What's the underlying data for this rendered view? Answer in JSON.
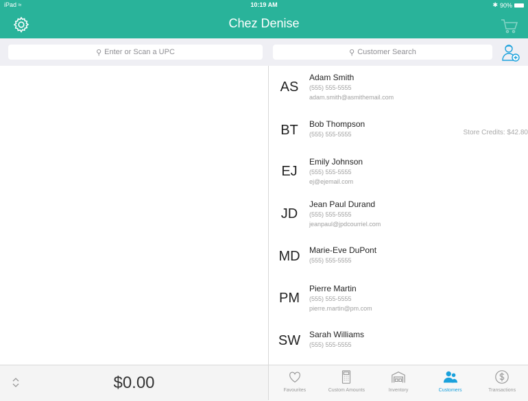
{
  "status": {
    "device": "iPad",
    "time": "10:19 AM",
    "battery": "90%"
  },
  "header": {
    "title": "Chez Denise",
    "icons": [
      "gear-icon",
      "cart-icon"
    ]
  },
  "search": {
    "upc_placeholder": "Enter or Scan a UPC",
    "customer_placeholder": "Customer Search"
  },
  "colors": {
    "brand": "#29b39a",
    "active_tab": "#1aa1dc"
  },
  "customers": [
    {
      "initials": "AS",
      "name": "Adam Smith",
      "phone": "(555) 555-5555",
      "email": "adam.smith@asmithemail.com",
      "credit": ""
    },
    {
      "initials": "BT",
      "name": "Bob Thompson",
      "phone": "(555) 555-5555",
      "email": "",
      "credit": "Store Credits: $42.80"
    },
    {
      "initials": "EJ",
      "name": "Emily Johnson",
      "phone": "(555) 555-5555",
      "email": "ej@ejemail.com",
      "credit": ""
    },
    {
      "initials": "JD",
      "name": "Jean Paul Durand",
      "phone": "(555) 555-5555",
      "email": "jeanpaul@jpdcourriel.com",
      "credit": ""
    },
    {
      "initials": "MD",
      "name": "Marie-Eve DuPont",
      "phone": "(555) 555-5555",
      "email": "",
      "credit": ""
    },
    {
      "initials": "PM",
      "name": "Pierre Martin",
      "phone": "(555) 555-5555",
      "email": "pierre.martin@pm.com",
      "credit": ""
    },
    {
      "initials": "SW",
      "name": "Sarah Williams",
      "phone": "(555) 555-5555",
      "email": "",
      "credit": ""
    }
  ],
  "total": "$0.00",
  "tabs": [
    {
      "label": "Favourites",
      "icon": "heart-icon"
    },
    {
      "label": "Custom Amounts",
      "icon": "calculator-icon"
    },
    {
      "label": "Inventory",
      "icon": "warehouse-icon"
    },
    {
      "label": "Customers",
      "icon": "customers-icon"
    },
    {
      "label": "Transactions",
      "icon": "dollar-icon"
    }
  ]
}
